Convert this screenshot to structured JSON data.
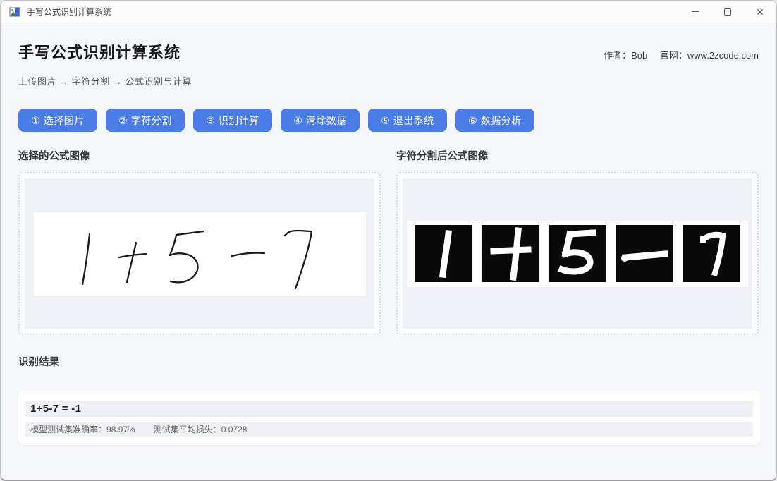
{
  "titlebar": {
    "title": "手写公式识别计算系统"
  },
  "header": {
    "title": "手写公式识别计算系统",
    "author": "作者：Bob",
    "website": "官网：www.2zcode.com"
  },
  "steps": {
    "text": "上传图片 → 字符分割 → 公式识别与计算"
  },
  "toolbar": {
    "buttons": [
      "① 选择图片",
      "② 字符分割",
      "③ 识别计算",
      "④ 清除数据",
      "⑤ 退出系统",
      "⑥ 数据分析"
    ]
  },
  "panels": {
    "original": {
      "label": "选择的公式图像",
      "formula_text": "1+5-7"
    },
    "segmented": {
      "label": "字符分割后公式图像",
      "characters": [
        "1",
        "+",
        "5",
        "-",
        "7"
      ]
    }
  },
  "results": {
    "label": "识别结果",
    "expression": "1+5-7 = -1",
    "accuracy_label": "模型测试集准确率：",
    "accuracy_value": "98.97%",
    "loss_label": "测试集平均损失：",
    "loss_value": "0.0728"
  },
  "colors": {
    "accent_blue": "#4b7be5",
    "panel_inner_bg": "#f1f2f7",
    "result_strip_bg": "#eef0f5",
    "segment_box_bg": "#0a0a0a"
  }
}
